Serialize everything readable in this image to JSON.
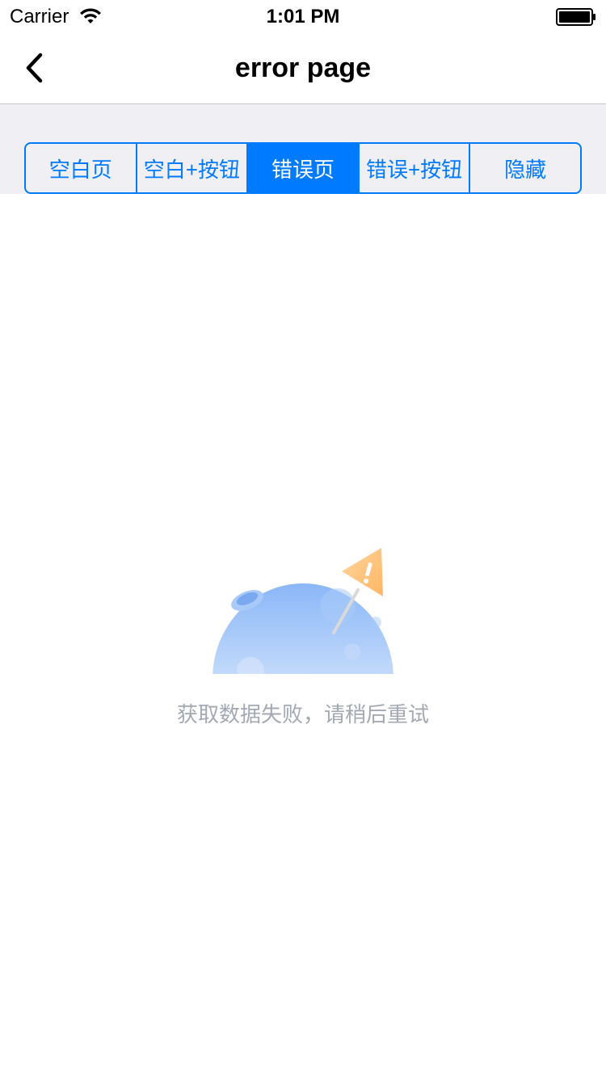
{
  "status_bar": {
    "carrier": "Carrier",
    "time": "1:01 PM",
    "wifi_icon": "wifi-icon",
    "battery_icon": "battery-icon"
  },
  "nav": {
    "title": "error page",
    "back_icon": "chevron-left-icon"
  },
  "segments": {
    "items": [
      {
        "label": "空白页"
      },
      {
        "label": "空白+按钮"
      },
      {
        "label": "错误页"
      },
      {
        "label": "错误+按钮"
      },
      {
        "label": "隐藏"
      }
    ],
    "selected_index": 2
  },
  "error_state": {
    "illustration_icon": "error-planet-warning-icon",
    "message": "获取数据失败，请稍后重试"
  },
  "colors": {
    "accent": "#007aff",
    "segment_background": "#efeff4",
    "message_text": "#a3a8b3",
    "warning_flag": "#ffc27a",
    "planet": "#8ab7f7"
  }
}
